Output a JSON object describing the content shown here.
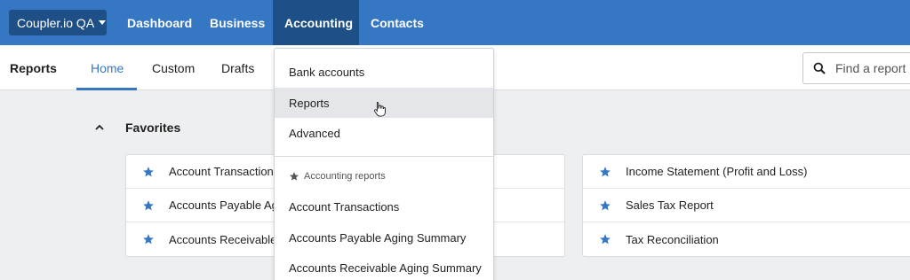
{
  "topnav": {
    "org_label": "Coupler.io QA",
    "items": [
      "Dashboard",
      "Business",
      "Accounting",
      "Contacts"
    ],
    "active": "Accounting"
  },
  "subnav": {
    "title": "Reports",
    "tabs": [
      "Home",
      "Custom",
      "Drafts"
    ],
    "active_tab": "Home",
    "search_placeholder": "Find a report"
  },
  "favorites": {
    "title": "Favorites",
    "left_card": [
      "Account Transactions",
      "Accounts Payable Ag",
      "Accounts Receivable"
    ],
    "right_card": [
      "Income Statement (Profit and Loss)",
      "Sales Tax Report",
      "Tax Reconciliation"
    ]
  },
  "dropdown": {
    "items": [
      "Bank accounts",
      "Reports",
      "Advanced"
    ],
    "hovered": "Reports",
    "section_header": "Accounting reports",
    "report_items": [
      "Account Transactions",
      "Accounts Payable Aging Summary",
      "Accounts Receivable Aging Summary"
    ]
  },
  "colors": {
    "brand": "#3677c4",
    "brand_dark": "#1e4f86",
    "star": "#3677c4"
  }
}
